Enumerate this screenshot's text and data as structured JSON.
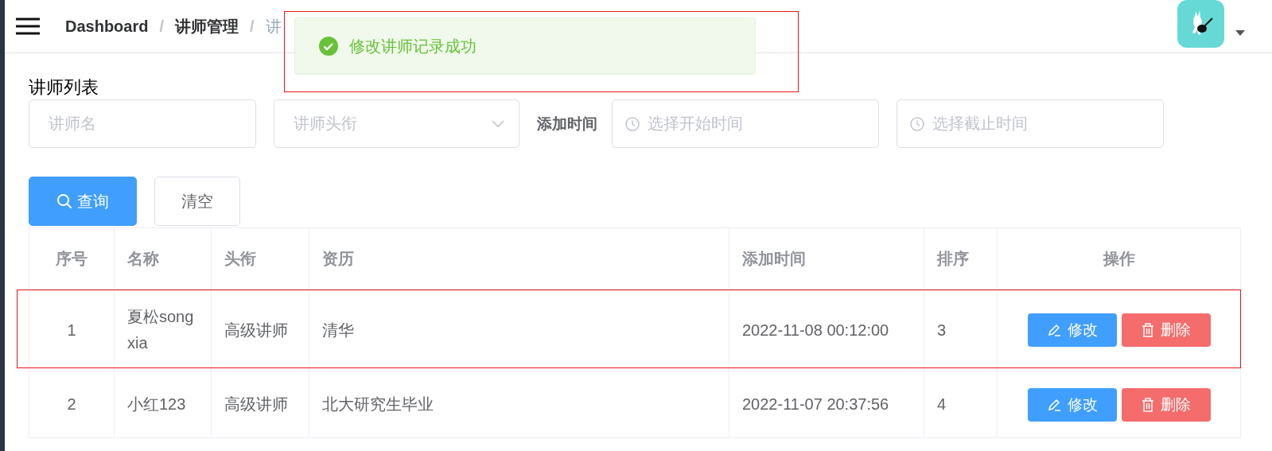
{
  "header": {
    "separator": "/",
    "breadcrumb": [
      {
        "label": "Dashboard",
        "current": false
      },
      {
        "label": "讲师管理",
        "current": false
      },
      {
        "label": "讲",
        "current": true
      }
    ]
  },
  "toast": {
    "kind": "success",
    "message": "修改讲师记录成功",
    "highlighted": true
  },
  "section_title": "讲师列表",
  "filters": {
    "name": {
      "placeholder": "讲师名"
    },
    "title_select": {
      "placeholder": "讲师头衔"
    },
    "date_label": "添加时间",
    "start": {
      "placeholder": "选择开始时间"
    },
    "end": {
      "placeholder": "选择截止时间"
    }
  },
  "buttons": [
    {
      "label": "查询",
      "kind": "primary"
    },
    {
      "label": "清空",
      "kind": "plain"
    }
  ],
  "table": {
    "columns": [
      "序号",
      "名称",
      "头衔",
      "资历",
      "添加时间",
      "排序",
      "操作"
    ],
    "rows": [
      {
        "cells": [
          "1",
          "夏松song xia",
          "高级讲师",
          "清华",
          "2022-11-08 00:12:00",
          "3"
        ],
        "actions": [
          "修改",
          "删除"
        ],
        "highlighted": true
      },
      {
        "cells": [
          "2",
          "小红123",
          "高级讲师",
          "北大研究生毕业",
          "2022-11-07 20:37:56",
          "4"
        ],
        "actions": [
          "修改",
          "删除"
        ],
        "highlighted": false
      }
    ]
  }
}
